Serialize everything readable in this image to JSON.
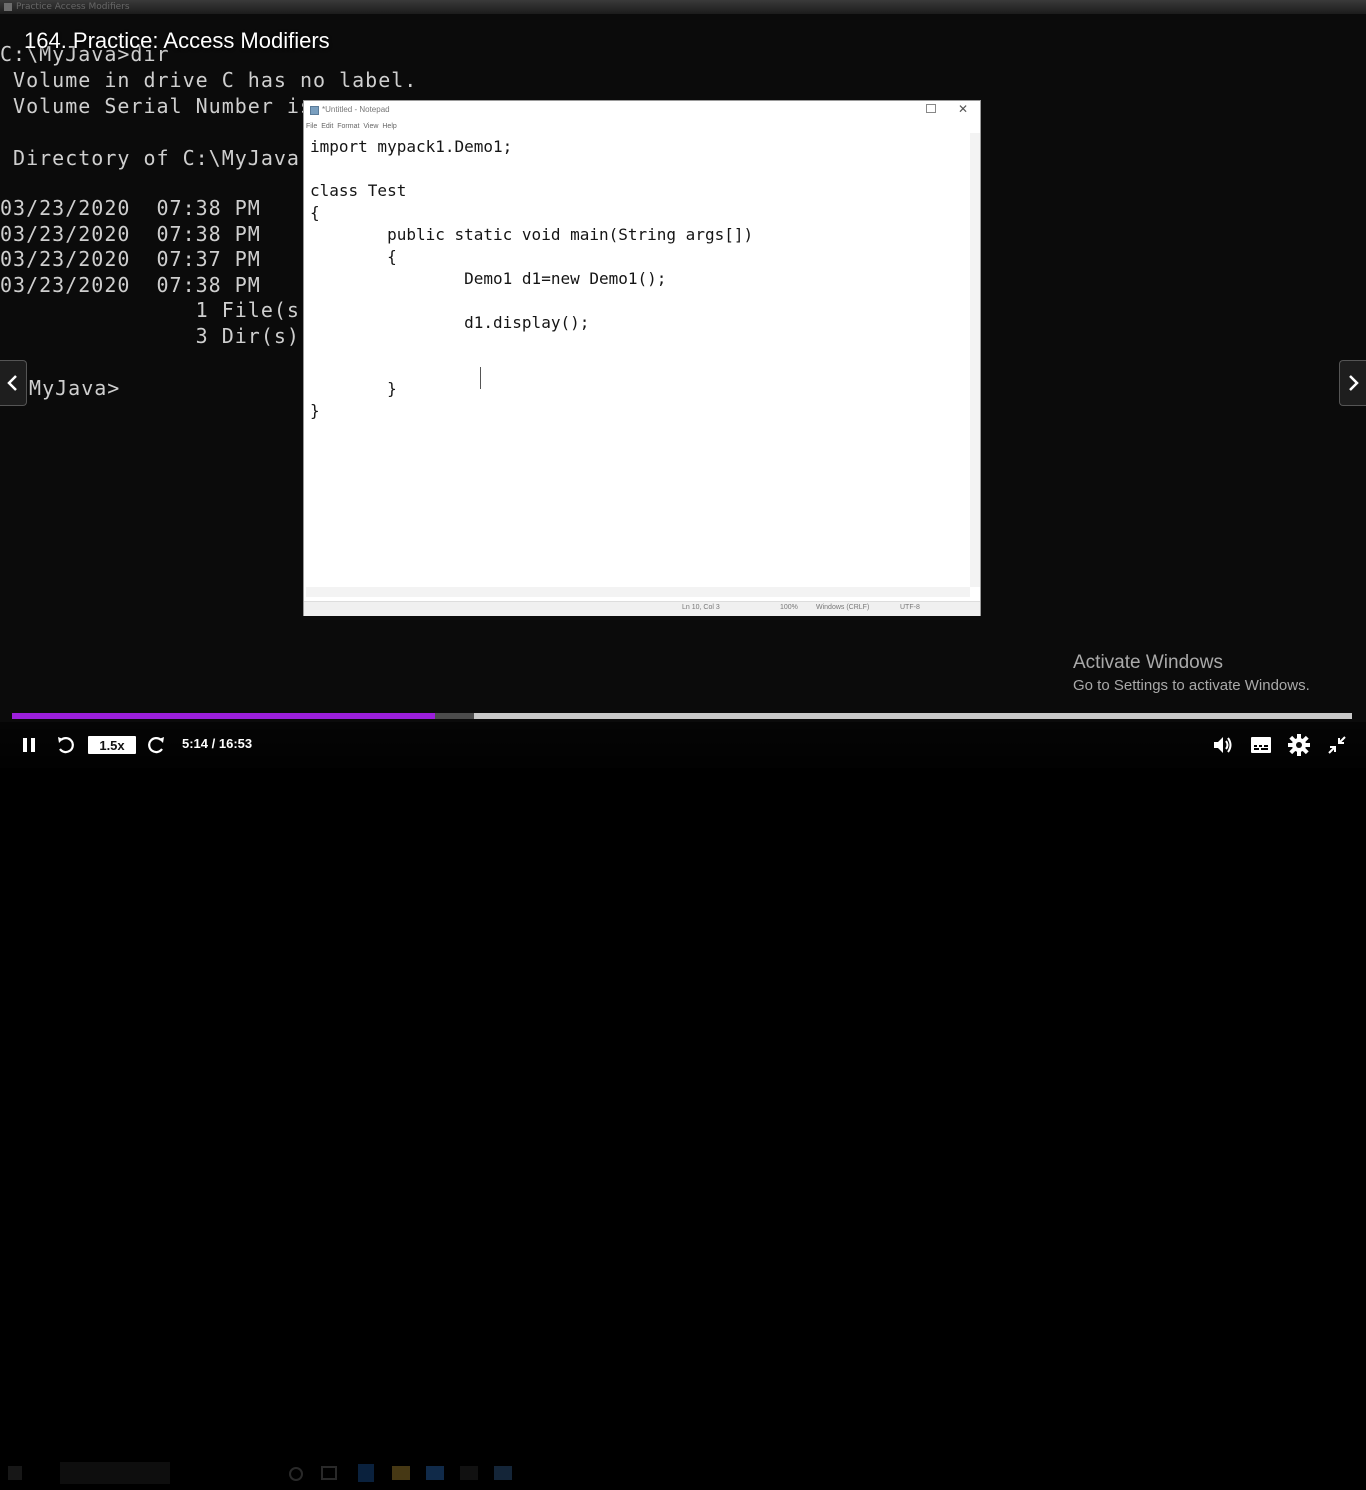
{
  "video": {
    "title": "164. Practice: Access Modifiers",
    "top_strip_text": "Practice Access Modifiers",
    "cmd_lines": [
      "C:\\MyJava>dir",
      " Volume in drive C has no label.",
      " Volume Serial Number is",
      "",
      " Directory of C:\\MyJava",
      "",
      "03/23/2020  07:38 PM",
      "03/23/2020  07:38 PM",
      "03/23/2020  07:37 PM",
      "03/23/2020  07:38 PM",
      "               1 File(s)",
      "               3 Dir(s)",
      "",
      "\\MyJava>"
    ],
    "notepad": {
      "title": "*Untitled - Notepad",
      "menu": [
        "File",
        "Edit",
        "Format",
        "View",
        "Help"
      ],
      "code_lines": [
        "import mypack1.Demo1;",
        "",
        "class Test",
        "{",
        "        public static void main(String args[])",
        "        {",
        "                Demo1 d1=new Demo1();",
        "",
        "                d1.display();",
        "",
        "",
        "",
        "        }",
        "}"
      ],
      "status": {
        "position": "Ln 10, Col 3",
        "zoom": "100%",
        "line_endings": "Windows (CRLF)",
        "encoding": "UTF-8"
      }
    },
    "watermark": {
      "title": "Activate Windows",
      "subtitle": "Go to Settings to activate Windows."
    }
  },
  "player": {
    "progress_fraction": 0.3156,
    "buffered_fraction": 0.345,
    "speed_label": "1.5x",
    "time_label": "5:14 / 16:53",
    "icons": {
      "prev": "chevron-left-icon",
      "next": "chevron-right-icon",
      "pause": "pause-icon",
      "rewind": "rewind-icon",
      "forward": "forward-icon",
      "volume": "volume-icon",
      "captions": "captions-icon",
      "settings": "gear-icon",
      "exit_fullscreen": "exit-fullscreen-icon"
    },
    "colors": {
      "progress": "#9c1fdc",
      "track": "#c9c9c9"
    }
  }
}
